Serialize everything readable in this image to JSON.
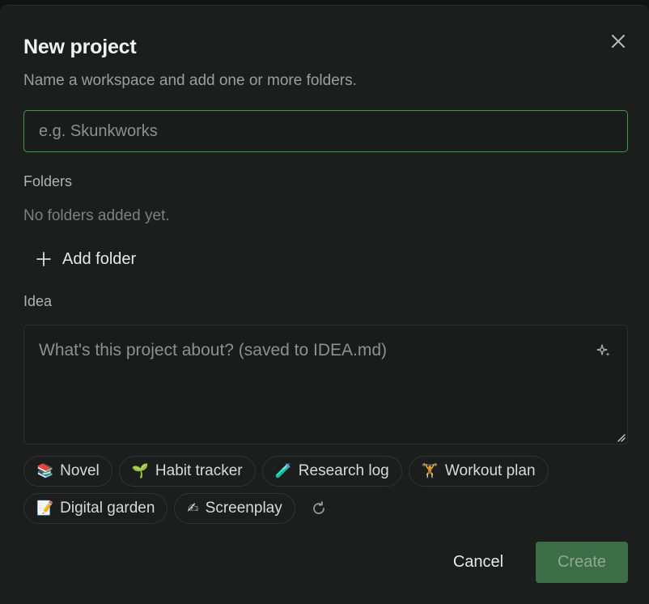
{
  "dialog": {
    "title": "New project",
    "subtitle": "Name a workspace and add one or more folders."
  },
  "name_input": {
    "value": "",
    "placeholder": "e.g. Skunkworks"
  },
  "folders": {
    "label": "Folders",
    "empty_text": "No folders added yet.",
    "add_label": "Add folder"
  },
  "idea": {
    "label": "Idea",
    "value": "",
    "placeholder": "What's this project about? (saved to IDEA.md)"
  },
  "suggestions": [
    {
      "emoji": "📚",
      "label": "Novel"
    },
    {
      "emoji": "🌱",
      "label": "Habit tracker"
    },
    {
      "emoji": "🧪",
      "label": "Research log"
    },
    {
      "emoji": "🏋",
      "label": "Workout plan"
    },
    {
      "emoji": "📝",
      "label": "Digital garden"
    },
    {
      "emoji": "✍",
      "label": "Screenplay"
    }
  ],
  "actions": {
    "cancel": "Cancel",
    "create": "Create"
  },
  "colors": {
    "accent_border": "#3f9a4f",
    "create_bg": "#3d6d47",
    "modal_bg": "#1c1e1d"
  },
  "icons": {
    "close": "close-icon",
    "add": "plus-icon",
    "enhance": "sparkle-icon",
    "refresh": "refresh-icon",
    "resize": "resize-grip-icon"
  }
}
